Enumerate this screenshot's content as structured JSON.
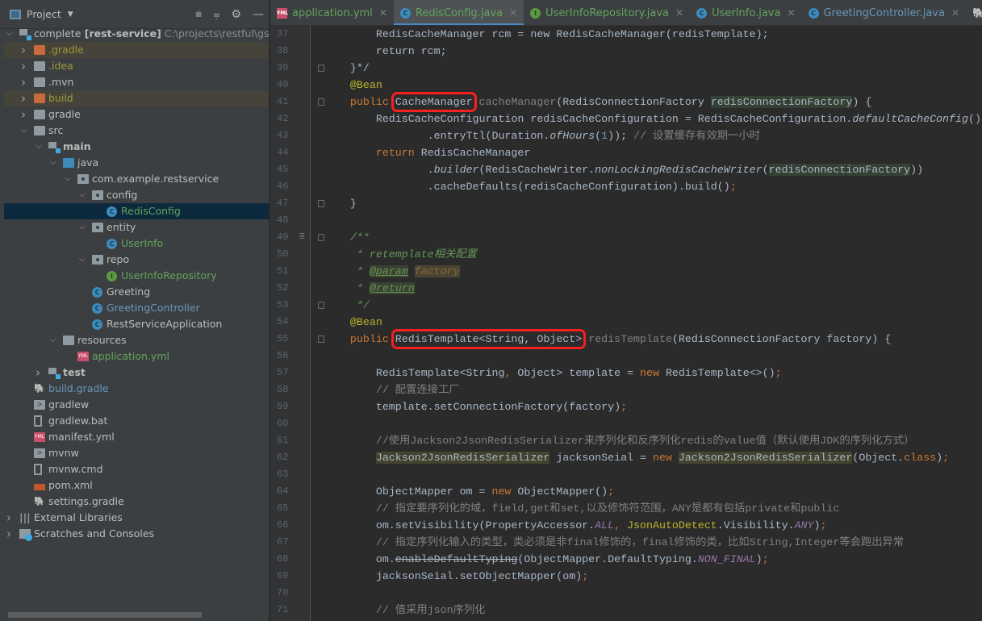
{
  "project_panel": {
    "title": "Project",
    "tools": [
      "expand-all-icon",
      "collapse-all-icon",
      "gear-icon",
      "minimize-icon"
    ],
    "tree": [
      {
        "level": 0,
        "arrow": "open",
        "icon": "module",
        "label": "complete",
        "bold": "[rest-service]",
        "path": "C:\\projects\\restful\\gs-res",
        "color": "#bbbbbb"
      },
      {
        "level": 1,
        "arrow": "closed",
        "icon": "folder-orange",
        "label": ".gradle",
        "color": "#a09b3a",
        "state": "excluded"
      },
      {
        "level": 1,
        "arrow": "closed",
        "icon": "folder",
        "label": ".idea",
        "color": "#a09b3a"
      },
      {
        "level": 1,
        "arrow": "closed",
        "icon": "folder",
        "label": ".mvn",
        "color": "#bbbbbb"
      },
      {
        "level": 1,
        "arrow": "closed",
        "icon": "folder-orange",
        "label": "build",
        "color": "#a09b3a",
        "state": "excluded"
      },
      {
        "level": 1,
        "arrow": "closed",
        "icon": "folder",
        "label": "gradle",
        "color": "#bbbbbb"
      },
      {
        "level": 1,
        "arrow": "open",
        "icon": "folder",
        "label": "src",
        "color": "#bbbbbb"
      },
      {
        "level": 2,
        "arrow": "open",
        "icon": "module",
        "label": "main",
        "color": "#bbbbbb",
        "boldlabel": true
      },
      {
        "level": 3,
        "arrow": "open",
        "icon": "folder-blue",
        "label": "java",
        "color": "#bbbbbb"
      },
      {
        "level": 4,
        "arrow": "open",
        "icon": "package",
        "label": "com.example.restservice",
        "color": "#bbbbbb"
      },
      {
        "level": 5,
        "arrow": "open",
        "icon": "package",
        "label": "config",
        "color": "#bbbbbb"
      },
      {
        "level": 6,
        "arrow": "none",
        "icon": "class",
        "label": "RedisConfig",
        "color": "#62a35c",
        "state": "selected"
      },
      {
        "level": 5,
        "arrow": "open",
        "icon": "package",
        "label": "entity",
        "color": "#bbbbbb"
      },
      {
        "level": 6,
        "arrow": "none",
        "icon": "class",
        "label": "UserInfo",
        "color": "#62a35c"
      },
      {
        "level": 5,
        "arrow": "open",
        "icon": "package",
        "label": "repo",
        "color": "#bbbbbb"
      },
      {
        "level": 6,
        "arrow": "none",
        "icon": "interface",
        "label": "UserInfoRepository",
        "color": "#62a35c"
      },
      {
        "level": 5,
        "arrow": "none",
        "icon": "class",
        "label": "Greeting",
        "color": "#bbbbbb"
      },
      {
        "level": 5,
        "arrow": "none",
        "icon": "class",
        "label": "GreetingController",
        "color": "#6897bb"
      },
      {
        "level": 5,
        "arrow": "none",
        "icon": "class",
        "label": "RestServiceApplication",
        "color": "#bbbbbb"
      },
      {
        "level": 3,
        "arrow": "open",
        "icon": "folder",
        "label": "resources",
        "color": "#bbbbbb"
      },
      {
        "level": 4,
        "arrow": "none",
        "icon": "yml",
        "label": "application.yml",
        "color": "#62a35c"
      },
      {
        "level": 2,
        "arrow": "closed",
        "icon": "module",
        "label": "test",
        "color": "#bbbbbb",
        "boldlabel": true
      },
      {
        "level": 1,
        "arrow": "none",
        "icon": "gradle",
        "label": "build.gradle",
        "color": "#6897bb"
      },
      {
        "level": 1,
        "arrow": "none",
        "icon": "script",
        "label": "gradlew",
        "color": "#bbbbbb"
      },
      {
        "level": 1,
        "arrow": "none",
        "icon": "file",
        "label": "gradlew.bat",
        "color": "#bbbbbb"
      },
      {
        "level": 1,
        "arrow": "none",
        "icon": "yml",
        "label": "manifest.yml",
        "color": "#bbbbbb"
      },
      {
        "level": 1,
        "arrow": "none",
        "icon": "script",
        "label": "mvnw",
        "color": "#bbbbbb"
      },
      {
        "level": 1,
        "arrow": "none",
        "icon": "file",
        "label": "mvnw.cmd",
        "color": "#bbbbbb"
      },
      {
        "level": 1,
        "arrow": "none",
        "icon": "xml",
        "label": "pom.xml",
        "color": "#bbbbbb"
      },
      {
        "level": 1,
        "arrow": "none",
        "icon": "gradle",
        "label": "settings.gradle",
        "color": "#bbbbbb"
      },
      {
        "level": 0,
        "arrow": "closed",
        "icon": "libraries",
        "label": "External Libraries",
        "color": "#bbbbbb"
      },
      {
        "level": 0,
        "arrow": "closed",
        "icon": "scratches",
        "label": "Scratches and Consoles",
        "color": "#bbbbbb"
      }
    ]
  },
  "tabs": [
    {
      "label": "application.yml",
      "icon": "yml",
      "color": "#62a35c",
      "closable": true
    },
    {
      "label": "RedisConfig.java",
      "icon": "class",
      "color": "#62a35c",
      "active": true,
      "closable": true
    },
    {
      "label": "UserInfoRepository.java",
      "icon": "interface",
      "color": "#62a35c",
      "closable": true
    },
    {
      "label": "UserInfo.java",
      "icon": "class",
      "color": "#62a35c",
      "closable": true
    },
    {
      "label": "GreetingController.java",
      "icon": "class",
      "color": "#6897bb",
      "closable": true
    },
    {
      "label": "build.gradle",
      "icon": "gradle",
      "color": "#6897bb"
    }
  ],
  "editor": {
    "first_line": 37,
    "folds": [
      39,
      41,
      47,
      49,
      53,
      55
    ],
    "lines": [
      [
        [
          "        RedisCacheManager rcm = new RedisCacheManager(redisTemplate);",
          ""
        ]
      ],
      [
        [
          "        return rcm;",
          ""
        ]
      ],
      [
        [
          "    }*/",
          ""
        ]
      ],
      [
        [
          "    ",
          ""
        ],
        [
          "@Bean",
          "a"
        ]
      ],
      [
        [
          "    ",
          ""
        ],
        [
          "public",
          "k"
        ],
        [
          " ",
          ""
        ],
        [
          "CacheManager",
          "box"
        ],
        [
          " ",
          ""
        ],
        [
          "cacheManager",
          "g"
        ],
        [
          "(RedisConnectionFactory ",
          ""
        ],
        [
          "redisConnectionFactory",
          "hl"
        ],
        [
          ") {",
          ""
        ]
      ],
      [
        [
          "        RedisCacheConfiguration redisCacheConfiguration = RedisCacheConfiguration.",
          ""
        ],
        [
          "defaultCacheConfig",
          "i"
        ],
        [
          "()",
          ""
        ]
      ],
      [
        [
          "                .entryTtl(Duration.",
          ""
        ],
        [
          "ofHours",
          "i"
        ],
        [
          "(",
          ""
        ],
        [
          "1",
          "n"
        ],
        [
          ")); ",
          ""
        ],
        [
          "// 设置缓存有效期一小时",
          "c"
        ]
      ],
      [
        [
          "        ",
          ""
        ],
        [
          "return",
          "k"
        ],
        [
          " RedisCacheManager",
          ""
        ]
      ],
      [
        [
          "                .",
          ""
        ],
        [
          "builder",
          "i"
        ],
        [
          "(RedisCacheWriter.",
          ""
        ],
        [
          "nonLockingRedisCacheWriter",
          "i"
        ],
        [
          "(",
          ""
        ],
        [
          "redisConnectionFactory",
          "hl"
        ],
        [
          "))",
          ""
        ]
      ],
      [
        [
          "                .cacheDefaults(redisCacheConfiguration).build()",
          ""
        ],
        [
          ";",
          "k"
        ]
      ],
      [
        [
          "    }",
          ""
        ]
      ],
      [],
      [
        [
          "    ",
          ""
        ],
        [
          "/**",
          "d"
        ]
      ],
      [
        [
          "     * ",
          "d"
        ],
        [
          "retemplate",
          "d"
        ],
        [
          "相关配置",
          "d"
        ]
      ],
      [
        [
          "     * ",
          "d"
        ],
        [
          "@param",
          "t"
        ],
        [
          " ",
          ""
        ],
        [
          "factory",
          "p"
        ]
      ],
      [
        [
          "     * ",
          "d"
        ],
        [
          "@return",
          "t"
        ]
      ],
      [
        [
          "     */",
          "d"
        ]
      ],
      [
        [
          "    ",
          ""
        ],
        [
          "@Bean",
          "a"
        ]
      ],
      [
        [
          "    ",
          ""
        ],
        [
          "public",
          "k"
        ],
        [
          " ",
          ""
        ],
        [
          "RedisTemplate<String, Object>",
          "box"
        ],
        [
          " ",
          ""
        ],
        [
          "redisTemplate",
          "g"
        ],
        [
          "(RedisConnectionFactory factory) {",
          ""
        ]
      ],
      [],
      [
        [
          "        RedisTemplate<String",
          ""
        ],
        [
          ",",
          "k"
        ],
        [
          " Object> template = ",
          ""
        ],
        [
          "new",
          "k"
        ],
        [
          " RedisTemplate<>()",
          ""
        ],
        [
          ";",
          "k"
        ]
      ],
      [
        [
          "        ",
          ""
        ],
        [
          "// 配置连接工厂",
          "c"
        ]
      ],
      [
        [
          "        template.setConnectionFactory(factory)",
          ""
        ],
        [
          ";",
          "k"
        ]
      ],
      [],
      [
        [
          "        ",
          ""
        ],
        [
          "//使用Jackson2JsonRedisSerializer来序列化和反序列化redis的value值（默认使用JDK的序列化方式）",
          "c"
        ]
      ],
      [
        [
          "        ",
          ""
        ],
        [
          "Jackson2JsonRedisSerializer",
          "hs"
        ],
        [
          " jacksonSeial = ",
          ""
        ],
        [
          "new",
          "k"
        ],
        [
          " ",
          ""
        ],
        [
          "Jackson2JsonRedisSerializer",
          "hs"
        ],
        [
          "(Object.",
          ""
        ],
        [
          "class",
          "k"
        ],
        [
          ")",
          ""
        ],
        [
          ";",
          "k"
        ]
      ],
      [],
      [
        [
          "        ObjectMapper om = ",
          ""
        ],
        [
          "new",
          "k"
        ],
        [
          " ObjectMapper()",
          ""
        ],
        [
          ";",
          "k"
        ]
      ],
      [
        [
          "        ",
          ""
        ],
        [
          "// 指定要序列化的域，field,get和set,以及修饰符范围，ANY是都有包括private和public",
          "c"
        ]
      ],
      [
        [
          "        om.setVisibility(PropertyAccessor.",
          ""
        ],
        [
          "ALL",
          "f"
        ],
        [
          ", ",
          "k"
        ],
        [
          "JsonAutoDetect",
          "a"
        ],
        [
          ".Visibility.",
          ""
        ],
        [
          "ANY",
          "f"
        ],
        [
          ")",
          ""
        ],
        [
          ";",
          "k"
        ]
      ],
      [
        [
          "        ",
          ""
        ],
        [
          "// 指定序列化输入的类型，类必须是非final修饰的，final修饰的类，比如String,Integer等会跑出异常",
          "c"
        ]
      ],
      [
        [
          "        om.",
          ""
        ],
        [
          "enableDefaultTyping",
          "st"
        ],
        [
          "(ObjectMapper.DefaultTyping.",
          ""
        ],
        [
          "NON_FINAL",
          "f"
        ],
        [
          ")",
          ""
        ],
        [
          ";",
          "k"
        ]
      ],
      [
        [
          "        jacksonSeial.setObjectMapper(om)",
          ""
        ],
        [
          ";",
          "k"
        ]
      ],
      [],
      [
        [
          "        ",
          ""
        ],
        [
          "// 值采用json序列化",
          "c"
        ]
      ]
    ]
  }
}
